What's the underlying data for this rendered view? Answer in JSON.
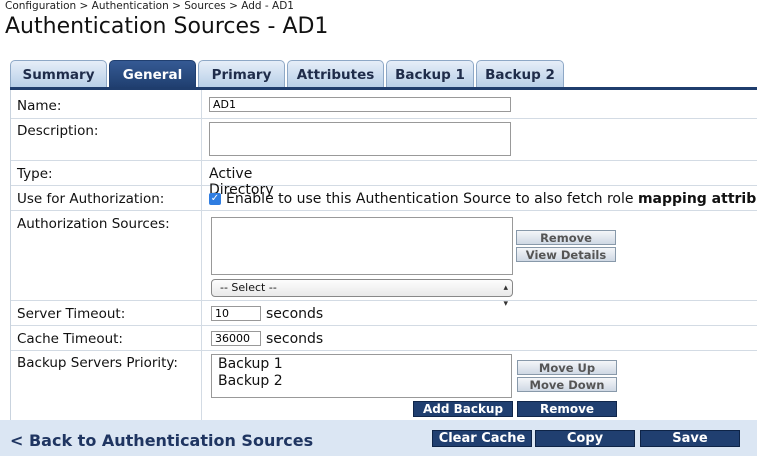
{
  "breadcrumb": "Configuration > Authentication > Sources > Add - AD1",
  "page_title": "Authentication Sources - AD1",
  "tabs": [
    "Summary",
    "General",
    "Primary",
    "Attributes",
    "Backup 1",
    "Backup 2"
  ],
  "active_tab": "General",
  "form": {
    "name_label": "Name:",
    "name_value": "AD1",
    "description_label": "Description:",
    "description_value": "",
    "type_label": "Type:",
    "type_value": "Active Directory",
    "use_for_auth_label": "Use for Authorization:",
    "use_for_auth_checked": true,
    "use_for_auth_text": "Enable to use this Authentication Source to also fetch role",
    "use_for_auth_text_bold": "mapping attributes",
    "auth_sources_label": "Authorization Sources:",
    "remove_label": "Remove",
    "view_details_label": "View Details",
    "select_value": "-- Select --",
    "server_timeout_label": "Server Timeout:",
    "server_timeout_value": "10",
    "cache_timeout_label": "Cache Timeout:",
    "cache_timeout_value": "36000",
    "seconds_label": "seconds",
    "backup_priority_label": "Backup Servers Priority:",
    "backup_items": [
      "Backup 1",
      "Backup 2"
    ],
    "move_up_label": "Move Up",
    "move_down_label": "Move Down",
    "add_backup_label": "Add Backup",
    "backup_remove_label": "Remove"
  },
  "footer": {
    "back_link": "< Back to Authentication Sources",
    "clear_cache": "Clear Cache",
    "copy": "Copy",
    "save": "Save"
  },
  "colors": {
    "tab_active": "#203f70",
    "button_dark": "#203f70",
    "footer_bg": "#dbe6f3",
    "checkbox": "#2f7de1"
  }
}
